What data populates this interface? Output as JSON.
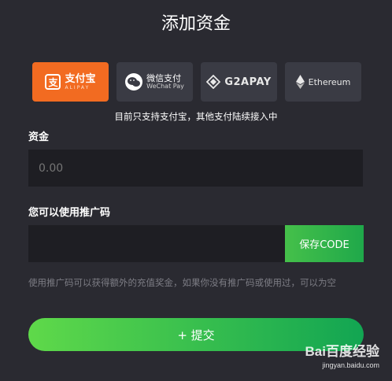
{
  "header": {
    "title": "添加资金"
  },
  "payment_methods": [
    {
      "id": "alipay",
      "label_cn": "支付宝",
      "label_en": "ALIPAY",
      "icon": "alipay-icon",
      "active": true
    },
    {
      "id": "wechat",
      "label_cn": "微信支付",
      "label_en": "WeChat Pay",
      "icon": "wechat-icon",
      "active": false
    },
    {
      "id": "g2apay",
      "label": "G2APAY",
      "icon": "g2a-icon",
      "active": false
    },
    {
      "id": "ethereum",
      "label": "Ethereum",
      "icon": "ethereum-icon",
      "active": false
    }
  ],
  "notice": "目前只支持支付宝，其他支付陆续接入中",
  "funds": {
    "label": "资金",
    "placeholder": "0.00"
  },
  "promo": {
    "label": "您可以使用推广码",
    "placeholder": "",
    "save_label": "保存CODE"
  },
  "hint": "使用推广码可以获得额外的充值奖金，如果你没有推广码或使用过，可以为空",
  "submit_label": "+ 提交",
  "watermark": {
    "brand": "Bai百度经验",
    "url": "jingyan.baidu.com"
  },
  "colors": {
    "background": "#2a2a31",
    "input_bg": "#1e1e23",
    "tile_bg": "#3a3b44",
    "alipay_active": "#f26b21",
    "accent_green_start": "#5fd94a",
    "accent_green_end": "#12a552"
  }
}
